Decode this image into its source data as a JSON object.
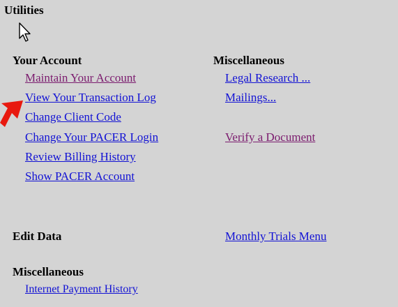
{
  "page": {
    "title": "Utilities"
  },
  "your_account": {
    "heading": "Your Account",
    "links": [
      {
        "label": "Maintain Your Account"
      },
      {
        "label": "View Your Transaction Log"
      },
      {
        "label": "Change Client Code"
      },
      {
        "label": "Change Your PACER Login"
      },
      {
        "label": "Review Billing History"
      },
      {
        "label": "Show PACER Account"
      }
    ]
  },
  "misc_top": {
    "heading": "Miscellaneous",
    "links": [
      {
        "label": "Legal Research ..."
      },
      {
        "label": "Mailings..."
      },
      {
        "label": "Verify a Document"
      }
    ]
  },
  "edit_data": {
    "heading": "Edit Data",
    "link": "Monthly Trials Menu"
  },
  "misc_bottom": {
    "heading": "Miscellaneous",
    "link": "Internet Payment History"
  },
  "colors": {
    "background": "#d4d4d4",
    "link": "#1212d4",
    "visited_link": "#7b1b6e",
    "annotation_arrow": "#e8190f"
  },
  "icons": [
    "mouse-pointer-icon",
    "red-arrow-annotation"
  ]
}
